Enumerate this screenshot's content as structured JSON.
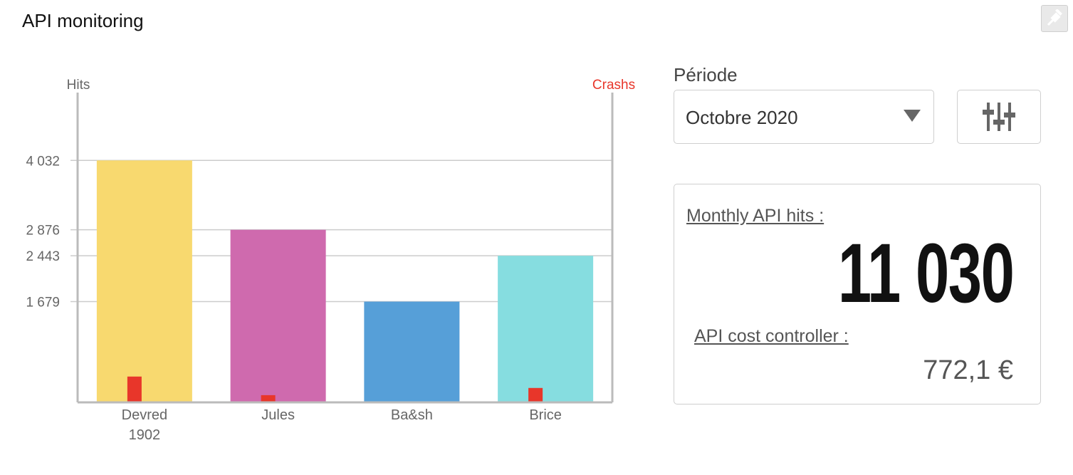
{
  "header": {
    "title": "API monitoring",
    "pin_icon": "pin-icon"
  },
  "chart_data": {
    "type": "bar",
    "left_axis_label": "Hits",
    "right_axis_label": "Crashs",
    "categories": [
      "Devred 1902",
      "Jules",
      "Ba&sh",
      "Brice"
    ],
    "category_lines": [
      [
        "Devred",
        "1902"
      ],
      [
        "Jules"
      ],
      [
        "Ba&sh"
      ],
      [
        "Brice"
      ]
    ],
    "series": [
      {
        "name": "Hits",
        "values": [
          4032,
          2876,
          1679,
          2443
        ],
        "colors": [
          "#f8d96f",
          "#cf6aae",
          "#569fd8",
          "#86dde0"
        ]
      },
      {
        "name": "Crashs",
        "values": [
          430,
          120,
          0,
          240
        ],
        "color": "#e8362a"
      }
    ],
    "y_ticks": [
      "4 032",
      "2 876",
      "2 443",
      "1 679"
    ],
    "y_tick_values": [
      4032,
      2876,
      2443,
      1679
    ],
    "ylim": [
      0,
      5400
    ],
    "crash_ylim": [
      0,
      5400
    ],
    "grid": true,
    "colors": {
      "axis": "#bbbbbb",
      "tick_text": "#666666",
      "crash_label": "#e8362a"
    }
  },
  "controls": {
    "period_label": "Période",
    "period_value": "Octobre 2020",
    "period_icon": "caret-down-icon",
    "filter_icon": "sliders-icon"
  },
  "stats": {
    "monthly_hits_label": "Monthly API hits :",
    "monthly_hits_value": "11 030",
    "cost_label": "API cost controller :",
    "cost_value": "772,1 €"
  }
}
